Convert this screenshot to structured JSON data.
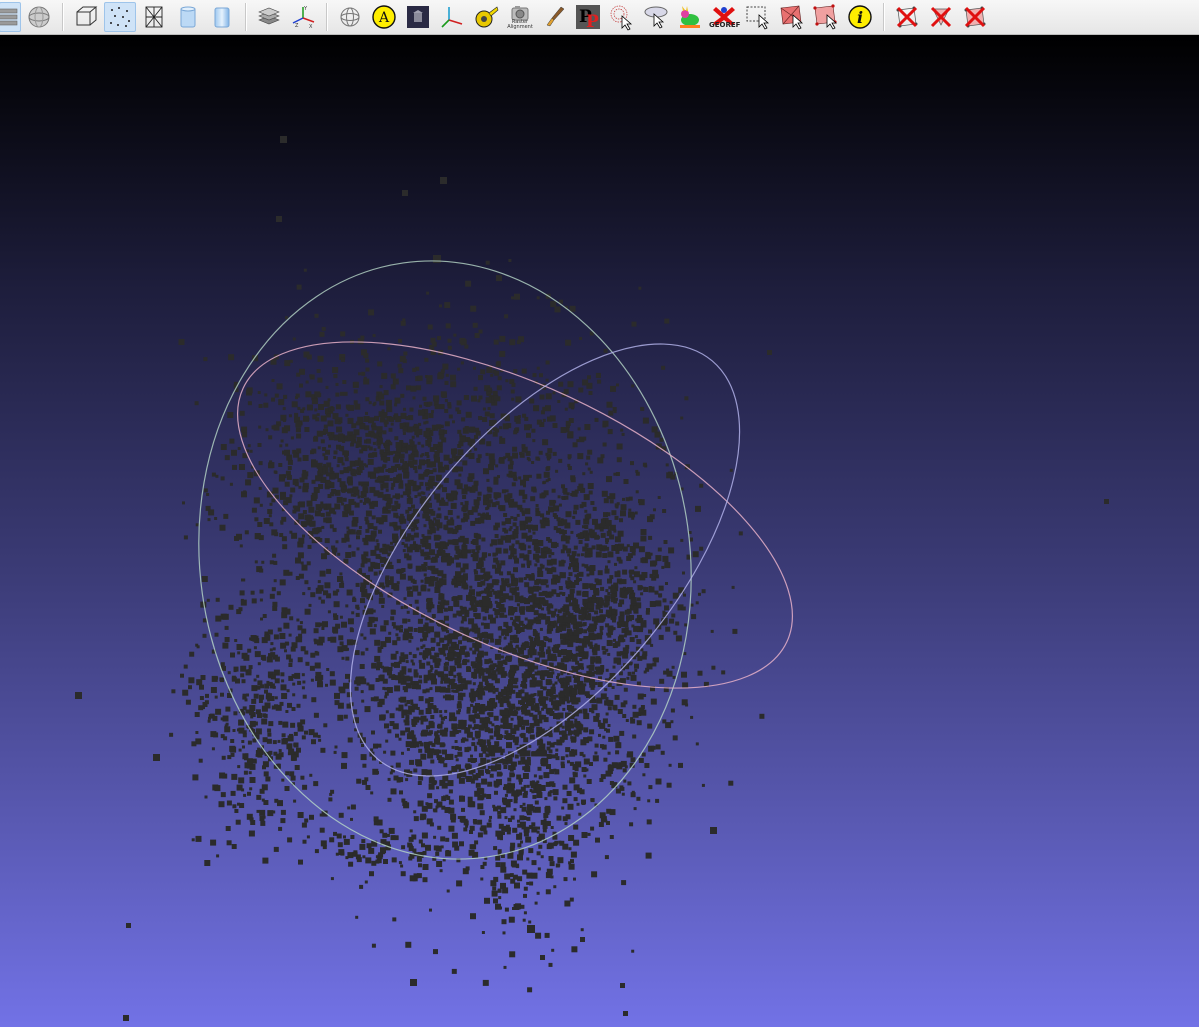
{
  "toolbar": {
    "raster_alignment_label": "Raster\nAlignment",
    "annotation_letter": "A",
    "georef_label": "GEOREF",
    "info_letter": "i",
    "point_picking_letters": "PP",
    "axis_labels": {
      "y": "Y",
      "z": "Z",
      "x": "X"
    },
    "buttons": [
      "layers-icon",
      "sphere-icon",
      "bounding-box-icon",
      "points-render-icon",
      "wireframe-icon",
      "flat-shading-icon",
      "smooth-shading-icon",
      "layer-stack-icon",
      "axes-icon",
      "trackball-icon",
      "annotation-icon",
      "raster-image-icon",
      "coordinate-frame-icon",
      "measure-tape-icon",
      "raster-alignment-icon",
      "paint-brush-icon",
      "point-picking-icon",
      "select-radius-icon",
      "select-connected-icon",
      "bunny-color-icon",
      "georef-icon",
      "select-rect-icon",
      "select-faces-icon",
      "select-vertices-icon",
      "info-icon",
      "delete-selected-faces-icon",
      "delete-selected-vertices-icon",
      "delete-all-selected-icon"
    ],
    "active_buttons": [
      "layers-icon",
      "points-render-icon"
    ]
  },
  "viewport": {
    "background_top": "#000000",
    "background_bottom": "#7272e6",
    "point_color": "#2b2b2b",
    "trackball_colors": [
      "#c8e6c8",
      "#e8b4c8",
      "#b4b4e6"
    ]
  }
}
